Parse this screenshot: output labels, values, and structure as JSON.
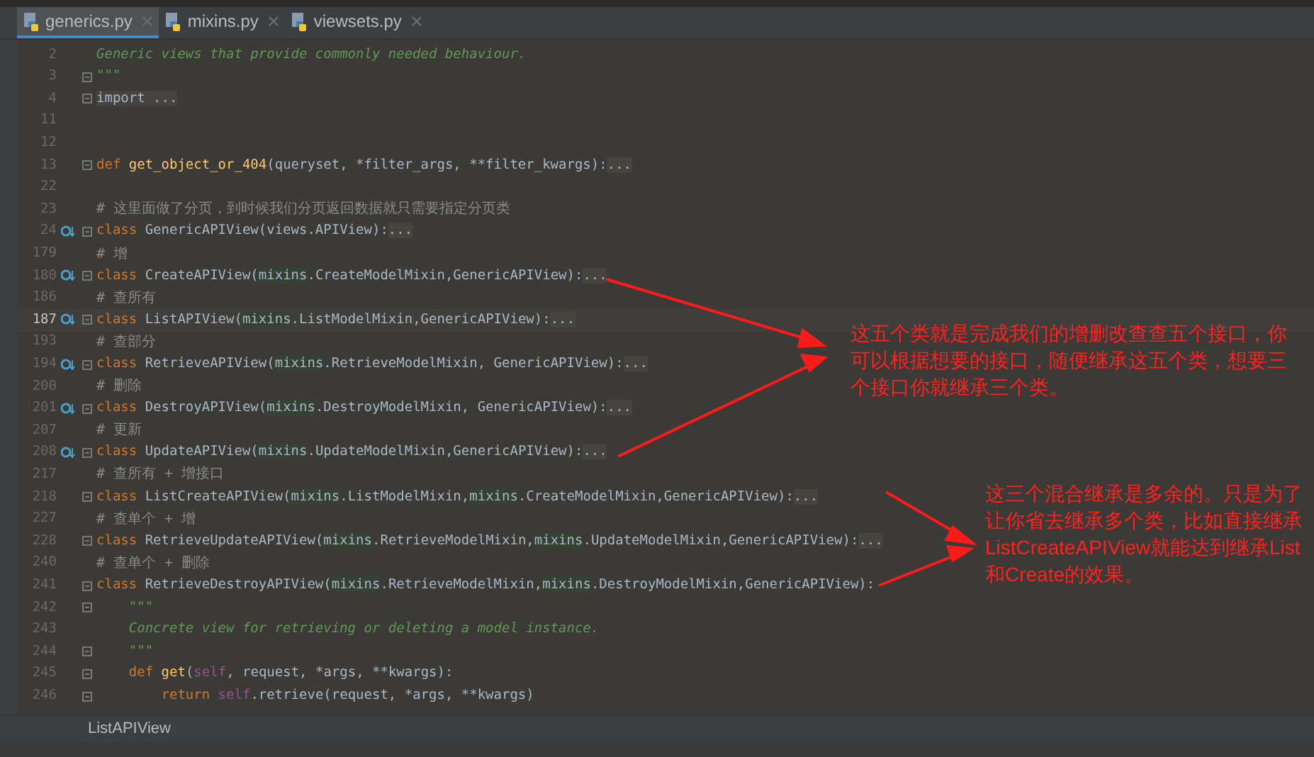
{
  "tabs": [
    {
      "label": "generics.py",
      "selected": true
    },
    {
      "label": "mixins.py",
      "selected": false
    },
    {
      "label": "viewsets.py",
      "selected": false
    }
  ],
  "lines": [
    {
      "n": "2",
      "marker": false,
      "current": false,
      "fold": false,
      "segs": [
        {
          "kind": "doc",
          "text": "Generic views that provide commonly needed behaviour."
        }
      ]
    },
    {
      "n": "3",
      "marker": false,
      "current": false,
      "fold": true,
      "segs": [
        {
          "kind": "doc",
          "text": "\"\"\""
        }
      ]
    },
    {
      "n": "4",
      "marker": false,
      "current": false,
      "fold": true,
      "segs": [
        {
          "kind": "fold",
          "text": "import ..."
        }
      ]
    },
    {
      "n": "11",
      "marker": false,
      "current": false,
      "fold": false
    },
    {
      "n": "12",
      "marker": false,
      "current": false,
      "fold": false
    },
    {
      "n": "13",
      "marker": false,
      "current": false,
      "fold": true,
      "segs": [
        {
          "kind": "kw",
          "text": "def "
        },
        {
          "kind": "fn",
          "text": "get_object_or_404"
        },
        {
          "kind": "txt",
          "text": "(queryset, *filter_args, **filter_kwargs):"
        },
        {
          "kind": "fold",
          "text": "..."
        }
      ]
    },
    {
      "n": "22",
      "marker": false,
      "current": false,
      "fold": false
    },
    {
      "n": "23",
      "marker": false,
      "current": false,
      "fold": false,
      "segs": [
        {
          "kind": "cm",
          "text": "# 这里面做了分页，到时候我们分页返回数据就只需要指定分页类"
        }
      ]
    },
    {
      "n": "24",
      "marker": true,
      "current": false,
      "fold": true,
      "segs": [
        {
          "kind": "kw",
          "text": "class "
        },
        {
          "kind": "txt",
          "text": "GenericAPIView(views.APIView):"
        },
        {
          "kind": "fold",
          "text": "..."
        }
      ]
    },
    {
      "n": "179",
      "marker": false,
      "current": false,
      "fold": false,
      "segs": [
        {
          "kind": "cm",
          "text": "# 增"
        }
      ]
    },
    {
      "n": "180",
      "marker": true,
      "current": false,
      "fold": true,
      "segs": [
        {
          "kind": "kw",
          "text": "class "
        },
        {
          "kind": "txt",
          "text": "CreateAPIView("
        },
        {
          "kind": "hl",
          "text": "mixins"
        },
        {
          "kind": "txt",
          "text": ".CreateModelMixin,GenericAPIView):"
        },
        {
          "kind": "fold",
          "text": "..."
        }
      ]
    },
    {
      "n": "186",
      "marker": false,
      "current": false,
      "fold": false,
      "segs": [
        {
          "kind": "cm",
          "text": "# 查所有"
        }
      ]
    },
    {
      "n": "187",
      "marker": true,
      "current": true,
      "fold": true,
      "segs": [
        {
          "kind": "kw",
          "text": "class "
        },
        {
          "kind": "txt",
          "text": "ListAPIView("
        },
        {
          "kind": "hl",
          "text": "mixins"
        },
        {
          "kind": "txt",
          "text": ".ListModelMixin,GenericAPIView):"
        },
        {
          "kind": "fold",
          "text": "..."
        }
      ]
    },
    {
      "n": "193",
      "marker": false,
      "current": false,
      "fold": false,
      "segs": [
        {
          "kind": "cm",
          "text": "# 查部分"
        }
      ]
    },
    {
      "n": "194",
      "marker": true,
      "current": false,
      "fold": true,
      "segs": [
        {
          "kind": "kw",
          "text": "class "
        },
        {
          "kind": "txt",
          "text": "RetrieveAPIView("
        },
        {
          "kind": "hl",
          "text": "mixins"
        },
        {
          "kind": "txt",
          "text": ".RetrieveModelMixin, GenericAPIView):"
        },
        {
          "kind": "fold",
          "text": "..."
        }
      ]
    },
    {
      "n": "200",
      "marker": false,
      "current": false,
      "fold": false,
      "segs": [
        {
          "kind": "cm",
          "text": "# 删除"
        }
      ]
    },
    {
      "n": "201",
      "marker": true,
      "current": false,
      "fold": true,
      "segs": [
        {
          "kind": "kw",
          "text": "class "
        },
        {
          "kind": "txt",
          "text": "DestroyAPIView("
        },
        {
          "kind": "hl",
          "text": "mixins"
        },
        {
          "kind": "txt",
          "text": ".DestroyModelMixin, GenericAPIView):"
        },
        {
          "kind": "fold",
          "text": "..."
        }
      ]
    },
    {
      "n": "207",
      "marker": false,
      "current": false,
      "fold": false,
      "segs": [
        {
          "kind": "cm",
          "text": "# 更新"
        }
      ]
    },
    {
      "n": "208",
      "marker": true,
      "current": false,
      "fold": true,
      "segs": [
        {
          "kind": "kw",
          "text": "class "
        },
        {
          "kind": "txt",
          "text": "UpdateAPIView("
        },
        {
          "kind": "hl",
          "text": "mixins"
        },
        {
          "kind": "txt",
          "text": ".UpdateModelMixin,GenericAPIView):"
        },
        {
          "kind": "fold",
          "text": "..."
        }
      ]
    },
    {
      "n": "217",
      "marker": false,
      "current": false,
      "fold": false,
      "segs": [
        {
          "kind": "cm",
          "text": "# 查所有 + 增接口"
        }
      ]
    },
    {
      "n": "218",
      "marker": false,
      "current": false,
      "fold": true,
      "segs": [
        {
          "kind": "kw",
          "text": "class "
        },
        {
          "kind": "txt",
          "text": "ListCreateAPIView("
        },
        {
          "kind": "hl",
          "text": "mixins"
        },
        {
          "kind": "txt",
          "text": ".ListModelMixin,"
        },
        {
          "kind": "hl",
          "text": "mixins"
        },
        {
          "kind": "txt",
          "text": ".CreateModelMixin,GenericAPIView):"
        },
        {
          "kind": "fold",
          "text": "..."
        }
      ]
    },
    {
      "n": "227",
      "marker": false,
      "current": false,
      "fold": false,
      "segs": [
        {
          "kind": "cm",
          "text": "# 查单个 + 增"
        }
      ]
    },
    {
      "n": "228",
      "marker": false,
      "current": false,
      "fold": true,
      "segs": [
        {
          "kind": "kw",
          "text": "class "
        },
        {
          "kind": "txt",
          "text": "RetrieveUpdateAPIView("
        },
        {
          "kind": "hl",
          "text": "mixins"
        },
        {
          "kind": "txt",
          "text": ".RetrieveModelMixin,"
        },
        {
          "kind": "hl",
          "text": "mixins"
        },
        {
          "kind": "txt",
          "text": ".UpdateModelMixin,GenericAPIView):"
        },
        {
          "kind": "fold",
          "text": "..."
        }
      ]
    },
    {
      "n": "240",
      "marker": false,
      "current": false,
      "fold": false,
      "segs": [
        {
          "kind": "cm",
          "text": "# 查单个 + 删除"
        }
      ]
    },
    {
      "n": "241",
      "marker": false,
      "current": false,
      "fold": true,
      "segs": [
        {
          "kind": "kw",
          "text": "class "
        },
        {
          "kind": "txt",
          "text": "RetrieveDestroyAPIView("
        },
        {
          "kind": "hl",
          "text": "mixins"
        },
        {
          "kind": "txt",
          "text": ".RetrieveModelMixin,"
        },
        {
          "kind": "hl",
          "text": "mixins"
        },
        {
          "kind": "txt",
          "text": ".DestroyModelMixin,GenericAPIView):"
        }
      ]
    },
    {
      "n": "242",
      "marker": false,
      "current": false,
      "fold": true,
      "segs": [
        {
          "kind": "doc",
          "text": "    \"\"\""
        }
      ]
    },
    {
      "n": "243",
      "marker": false,
      "current": false,
      "fold": false,
      "segs": [
        {
          "kind": "doc",
          "text": "    Concrete view for retrieving or deleting a model instance."
        }
      ]
    },
    {
      "n": "244",
      "marker": false,
      "current": false,
      "fold": true,
      "segs": [
        {
          "kind": "doc",
          "text": "    \"\"\""
        }
      ]
    },
    {
      "n": "245",
      "marker": false,
      "current": false,
      "fold": true,
      "segs": [
        {
          "kind": "kw",
          "text": "    def "
        },
        {
          "kind": "fn",
          "text": "get"
        },
        {
          "kind": "txt",
          "text": "("
        },
        {
          "kind": "self",
          "text": "self"
        },
        {
          "kind": "txt",
          "text": ", request, *args, **kwargs):"
        }
      ]
    },
    {
      "n": "246",
      "marker": false,
      "current": false,
      "fold": true,
      "segs": [
        {
          "kind": "kw",
          "text": "        return "
        },
        {
          "kind": "self",
          "text": "self"
        },
        {
          "kind": "txt",
          "text": ".retrieve(request, *args, **kwargs)"
        }
      ]
    }
  ],
  "annotations": [
    {
      "text": "这五个类就是完成我们的增删改查查五个接口，你可以根据想要的接口，随便继承这五个类，想要三个接口你就继承三个类。"
    },
    {
      "text": "这三个混合继承是多余的。只是为了让你省去继承多个类，比如直接继承ListCreateAPIView就能达到继承List和Create的效果。"
    }
  ],
  "breadcrumb": "ListAPIView"
}
